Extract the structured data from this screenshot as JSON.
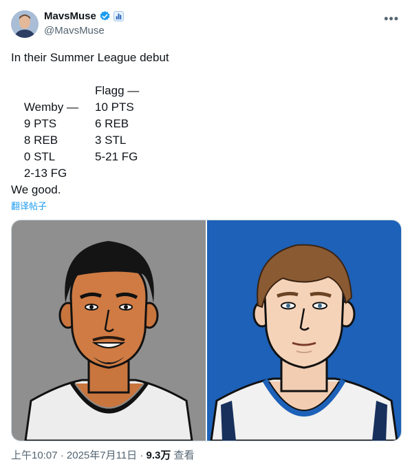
{
  "author": {
    "display_name": "MavsMuse",
    "handle": "@MavsMuse",
    "verified_icon": "verified-badge-icon",
    "label_icon": "bar-chart-label-icon",
    "more_icon": "more-dots-icon",
    "more_symbol": "•••"
  },
  "tweet": {
    "intro": "In their Summer League debut",
    "rows": [
      {
        "left": "Wemby —",
        "right": "Flagg —"
      },
      {
        "left": "9 PTS",
        "right": "10 PTS"
      },
      {
        "left": "8 REB",
        "right": "6 REB"
      },
      {
        "left": "0 STL",
        "right": "3 STL"
      },
      {
        "left": "2-13 FG",
        "right": "5-21 FG"
      }
    ],
    "closing": "We good."
  },
  "translate_label": "翻译帖子",
  "footer": {
    "time": "上午10:07",
    "separator": " · ",
    "date": "2025年7月11日",
    "views": "9.3万",
    "views_label": " 查看"
  },
  "colors": {
    "left_panel_bg": "#8f8f8f",
    "right_panel_bg": "#1d61b8",
    "link": "#1d9bf0",
    "verified": "#1d9bf0"
  }
}
